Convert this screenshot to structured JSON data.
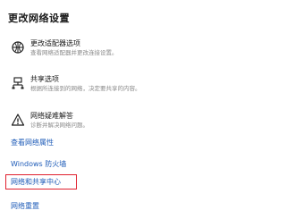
{
  "header": {
    "title": "更改网络设置"
  },
  "settings": [
    {
      "icon": "network-adapter-icon",
      "label": "更改适配器选项",
      "description": "查看网络适配器并更改连接设置。"
    },
    {
      "icon": "sharing-icon",
      "label": "共享选项",
      "description": "根据所连接到的网络，决定要共享的内容。"
    },
    {
      "icon": "warning-icon",
      "label": "网络疑难解答",
      "description": "诊断并解决网络问题。"
    }
  ],
  "links": {
    "view_properties": "查看网络属性",
    "firewall": "Windows 防火墙",
    "network_sharing_center": "网络和共享中心",
    "network_reset": "网络重置"
  },
  "colors": {
    "link": "#1f5cb8",
    "highlight": "#e0202e",
    "description": "#8a8a8a"
  }
}
